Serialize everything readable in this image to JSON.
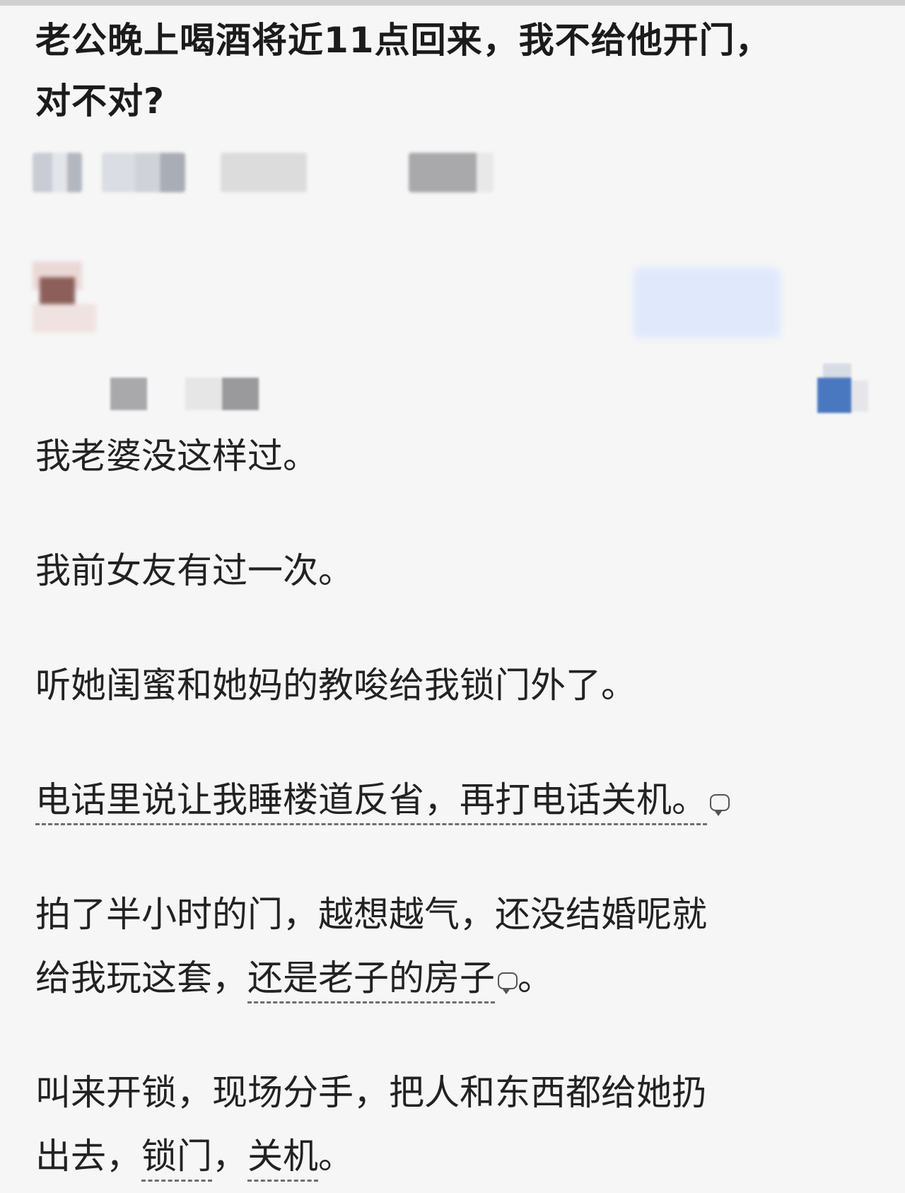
{
  "question": {
    "title_line1": "老公晚上喝酒将近11点回来，我不给他开门，",
    "title_line2": "对不对?"
  },
  "answer": {
    "paragraphs": [
      "我老婆没这样过。",
      "我前女友有过一次。",
      "听她闺蜜和她妈的教唆给我锁门外了。",
      {
        "dotted_text": "电话里说让我睡楼道反省，再打电话关机。"
      },
      {
        "line1": "拍了半小时的门，越想越气，还没结婚呢就",
        "line2_prefix": "给我玩这套，",
        "line2_dotted": "还是老子的房子",
        "line2_suffix": "。"
      },
      {
        "line1": "叫来开锁，现场分手，把人和东西都给她扔",
        "line2_a": "出去，",
        "line2_b": "锁门",
        "line2_c": "，",
        "line2_d": "关机",
        "line2_e": "。"
      }
    ]
  },
  "colors": {
    "background": "#f6f6f6",
    "text": "#222222",
    "follow_button_blurred": "#dfe9fb",
    "accent_icon_blurred": "#4a78c0"
  },
  "icons": {
    "comment_marker": "comment-bubble-icon",
    "more_menu": "more-icon"
  }
}
